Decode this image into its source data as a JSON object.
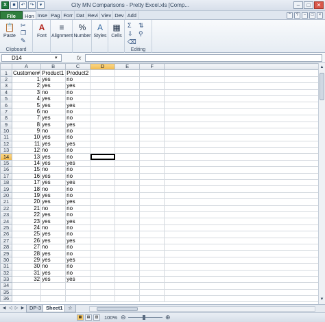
{
  "window": {
    "title": "City MN Comparisons - Pretty Excel.xls [Comp..."
  },
  "quick_access": {
    "app_icon": "X",
    "save_icon": "save-icon",
    "undo_icon": "undo-icon",
    "redo_icon": "redo-icon"
  },
  "tabs": [
    {
      "label": "File"
    },
    {
      "label": "Hon"
    },
    {
      "label": "Inse"
    },
    {
      "label": "Pag"
    },
    {
      "label": "Forr"
    },
    {
      "label": "Dat"
    },
    {
      "label": "Revi"
    },
    {
      "label": "Viev"
    },
    {
      "label": "Dev"
    },
    {
      "label": "Add"
    }
  ],
  "ribbon": {
    "clipboard": {
      "group_label": "Clipboard",
      "paste_label": "Paste"
    },
    "font": {
      "label": "Font"
    },
    "alignment": {
      "label": "Alignment"
    },
    "number": {
      "label": "Number"
    },
    "styles": {
      "label": "Styles"
    },
    "cells": {
      "label": "Cells"
    },
    "editing": {
      "group_label": "Editing"
    }
  },
  "formula_bar": {
    "name_box": "D14",
    "fx_label": "fx",
    "value": ""
  },
  "grid": {
    "columns": [
      "A",
      "B",
      "C",
      "D",
      "E",
      "F"
    ],
    "selected_column": "D",
    "selected_row": "14",
    "header_row": [
      "Customer#",
      "Product1",
      "Product2"
    ],
    "rows": [
      {
        "r": "1",
        "a": "Customer#",
        "b": "Product1",
        "c": "Product2"
      },
      {
        "r": "2",
        "a": "1",
        "b": "yes",
        "c": "no"
      },
      {
        "r": "3",
        "a": "2",
        "b": "yes",
        "c": "yes"
      },
      {
        "r": "4",
        "a": "3",
        "b": "no",
        "c": "no"
      },
      {
        "r": "5",
        "a": "4",
        "b": "yes",
        "c": "no"
      },
      {
        "r": "6",
        "a": "5",
        "b": "yes",
        "c": "yes"
      },
      {
        "r": "7",
        "a": "6",
        "b": "no",
        "c": "no"
      },
      {
        "r": "8",
        "a": "7",
        "b": "yes",
        "c": "no"
      },
      {
        "r": "9",
        "a": "8",
        "b": "yes",
        "c": "yes"
      },
      {
        "r": "10",
        "a": "9",
        "b": "no",
        "c": "no"
      },
      {
        "r": "11",
        "a": "10",
        "b": "yes",
        "c": "no"
      },
      {
        "r": "12",
        "a": "11",
        "b": "yes",
        "c": "yes"
      },
      {
        "r": "13",
        "a": "12",
        "b": "no",
        "c": "no"
      },
      {
        "r": "14",
        "a": "13",
        "b": "yes",
        "c": "no"
      },
      {
        "r": "15",
        "a": "14",
        "b": "yes",
        "c": "yes"
      },
      {
        "r": "16",
        "a": "15",
        "b": "no",
        "c": "no"
      },
      {
        "r": "17",
        "a": "16",
        "b": "yes",
        "c": "no"
      },
      {
        "r": "18",
        "a": "17",
        "b": "yes",
        "c": "yes"
      },
      {
        "r": "19",
        "a": "18",
        "b": "no",
        "c": "no"
      },
      {
        "r": "20",
        "a": "19",
        "b": "yes",
        "c": "no"
      },
      {
        "r": "21",
        "a": "20",
        "b": "yes",
        "c": "yes"
      },
      {
        "r": "22",
        "a": "21",
        "b": "no",
        "c": "no"
      },
      {
        "r": "23",
        "a": "22",
        "b": "yes",
        "c": "no"
      },
      {
        "r": "24",
        "a": "23",
        "b": "yes",
        "c": "yes"
      },
      {
        "r": "25",
        "a": "24",
        "b": "no",
        "c": "no"
      },
      {
        "r": "26",
        "a": "25",
        "b": "yes",
        "c": "no"
      },
      {
        "r": "27",
        "a": "26",
        "b": "yes",
        "c": "yes"
      },
      {
        "r": "28",
        "a": "27",
        "b": "no",
        "c": "no"
      },
      {
        "r": "29",
        "a": "28",
        "b": "yes",
        "c": "no"
      },
      {
        "r": "30",
        "a": "29",
        "b": "yes",
        "c": "yes"
      },
      {
        "r": "31",
        "a": "30",
        "b": "no",
        "c": "no"
      },
      {
        "r": "32",
        "a": "31",
        "b": "yes",
        "c": "no"
      },
      {
        "r": "33",
        "a": "32",
        "b": "yes",
        "c": "yes"
      },
      {
        "r": "34",
        "a": "",
        "b": "",
        "c": ""
      },
      {
        "r": "35",
        "a": "",
        "b": "",
        "c": ""
      },
      {
        "r": "36",
        "a": "",
        "b": "",
        "c": ""
      }
    ]
  },
  "sheets": [
    {
      "label": "DP-3"
    },
    {
      "label": "Sheet1"
    }
  ],
  "active_sheet": "Sheet1",
  "status": {
    "zoom": "100%"
  },
  "colors": {
    "file_tab": "#2f7f3f",
    "selected_header": "#f2b94b"
  }
}
